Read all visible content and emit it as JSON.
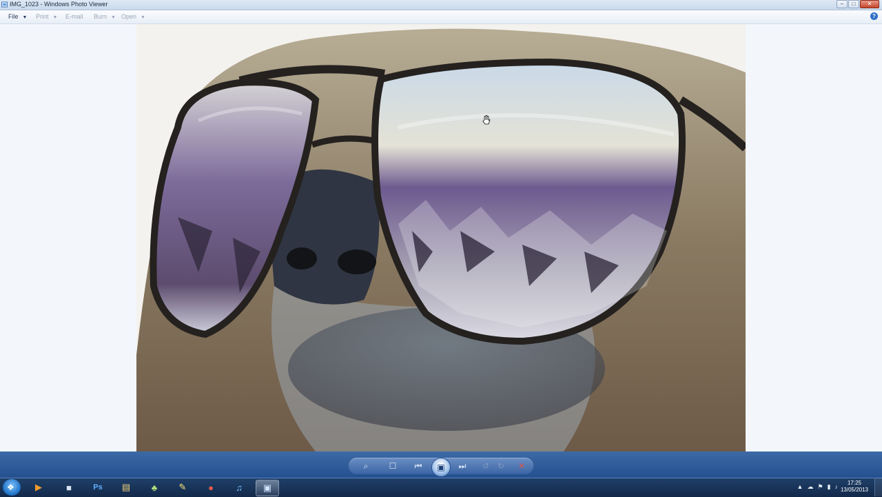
{
  "window": {
    "title": "IMG_1023 - Windows Photo Viewer",
    "controls": {
      "minimize": "–",
      "maximize": "□",
      "close": "✕"
    }
  },
  "menubar": {
    "items": [
      {
        "label": "File",
        "enabled": true
      },
      {
        "label": "Print",
        "enabled": false
      },
      {
        "label": "E-mail",
        "enabled": false
      },
      {
        "label": "Burn",
        "enabled": false
      },
      {
        "label": "Open",
        "enabled": false
      }
    ],
    "help": "?"
  },
  "controls": {
    "zoom": "⌕",
    "actual_size": "☐",
    "previous": "⏮",
    "slideshow": "▣",
    "next": "⏭",
    "rotate_ccw": "↺",
    "rotate_cw": "↻",
    "delete": "✕"
  },
  "taskbar": {
    "items": [
      {
        "name": "media-player",
        "glyph": "▶"
      },
      {
        "name": "window-manager",
        "glyph": "■"
      },
      {
        "name": "photoshop",
        "glyph": "Ps"
      },
      {
        "name": "explorer",
        "glyph": "▤"
      },
      {
        "name": "app-icon",
        "glyph": "♣"
      },
      {
        "name": "paint-tool",
        "glyph": "✎"
      },
      {
        "name": "chrome",
        "glyph": "●"
      },
      {
        "name": "itunes",
        "glyph": "♫"
      },
      {
        "name": "photo-viewer",
        "glyph": "▣"
      }
    ],
    "clock": {
      "time": "17:25",
      "date": "13/05/2013"
    }
  },
  "colors": {
    "accent": "#24508f",
    "taskbar": "#13294a",
    "background": "#f3f6fb"
  }
}
